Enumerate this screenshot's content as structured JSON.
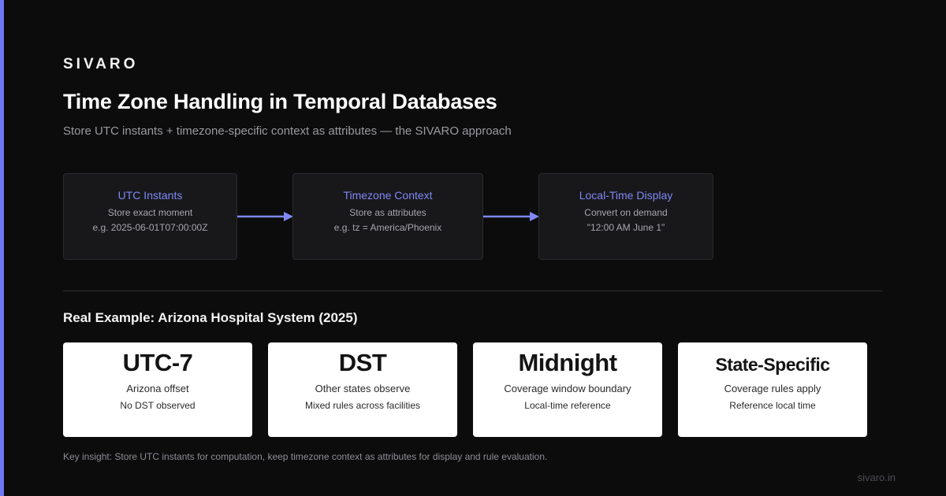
{
  "brand": "SIVARO",
  "title": "Time Zone Handling in Temporal Databases",
  "subtitle": "Store UTC instants + timezone-specific context as attributes — the SIVARO approach",
  "colors": {
    "accent": "#6f78f2",
    "background": "#0c0c0d",
    "box_title": "#7f88f5"
  },
  "flow": [
    {
      "title": "UTC Instants",
      "line1": "Store exact moment",
      "line2": "e.g. 2025-06-01T07:00:00Z"
    },
    {
      "title": "Timezone Context",
      "line1": "Store as attributes",
      "line2": "e.g. tz = America/Phoenix"
    },
    {
      "title": "Local-Time Display",
      "line1": "Convert on demand",
      "line2": "\"12:00 AM June 1\""
    }
  ],
  "example_heading": "Real Example: Arizona Hospital System (2025)",
  "cards": [
    {
      "big": "UTC-7",
      "line1": "Arizona offset",
      "line2": "No DST observed"
    },
    {
      "big": "DST",
      "line1": "Other states observe",
      "line2": "Mixed rules across facilities"
    },
    {
      "big": "Midnight",
      "line1": "Coverage window boundary",
      "line2": "Local-time reference"
    },
    {
      "big": "State-Specific",
      "line1": "Coverage rules apply",
      "line2": "Reference local time"
    }
  ],
  "insight": "Key insight: Store UTC instants for computation, keep timezone context as attributes for display and rule evaluation.",
  "footer_url": "sivaro.in"
}
